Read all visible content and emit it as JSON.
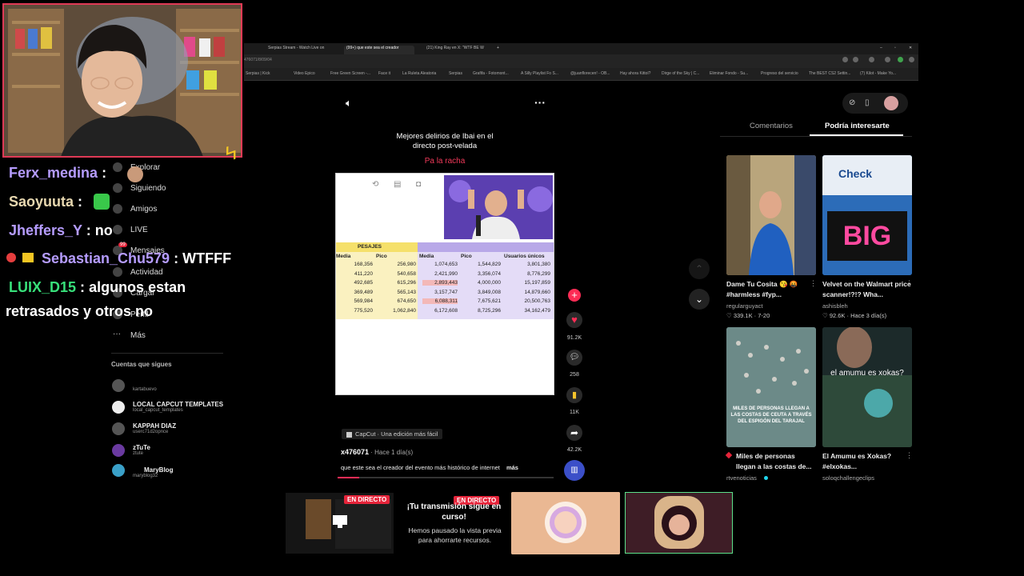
{
  "browser": {
    "tabs": [
      "Serpias Stream - Watch Live on",
      "(99+) que este sea el creador",
      "(21) King Ray en X: \"WTF BE W"
    ],
    "address": "476071/8/09/04",
    "bookmarks": [
      "Serpias | Kick",
      "Video Epico",
      "Free Green Screen -...",
      "Face it",
      "La Ruleta Aleatoria",
      "Serpias",
      "Grafifa - Fotomont...",
      "A Silly Playlist Fo S...",
      "@juanflorecen! - OB...",
      "Hay ahora Kittol?",
      "Dirge of the Sky | C...",
      "Eliminar Fondo - Su...",
      "Progreso del servicio",
      "The BEST CS2 Settin...",
      "(7) Kilot - Make Yo..."
    ]
  },
  "chat": [
    {
      "user": "Ferx_medina",
      "sep": " :",
      "msg": "",
      "color": "#b59cff"
    },
    {
      "user": "Saoyuuta",
      "sep": " :",
      "msg": "",
      "color": "#e8d8b0"
    },
    {
      "user": "Jheffers_Y",
      "sep": " :",
      "msg": "no",
      "color": "#b59cff"
    },
    {
      "user": "Sebastian_Chu579",
      "sep": " :",
      "msg": "WTFFF",
      "color": "#b59cff"
    },
    {
      "user": "LUIX_D15",
      "sep": " :",
      "msg": "algunos estan",
      "color": "#38e07a"
    },
    {
      "user": "",
      "sep": "",
      "msg": "retrasados y otros no",
      "color": "#fff"
    }
  ],
  "sidebar": {
    "items": [
      "Explorar",
      "Siguiendo",
      "Amigos",
      "LIVE",
      "Mensajes",
      "Actividad",
      "Cargar",
      "Perfil",
      "Más"
    ],
    "messages_badge": "99",
    "following_title": "Cuentas que sigues",
    "accounts": [
      {
        "name": "",
        "sub": "kartabuevo"
      },
      {
        "name": "LOCAL CAPCUT TEMPLATES",
        "sub": "local_capcut_templates"
      },
      {
        "name": "KAPPAH DIAZ",
        "sub": "userc71d2opnce"
      },
      {
        "name": "zTuTe",
        "sub": "ztute"
      },
      {
        "name": "MaryBlog",
        "sub": "maryblog32"
      }
    ]
  },
  "video": {
    "overlay_title": "Mejores delirios de Ibai en el directo post-velada",
    "overlay_sub": "Pa la racha",
    "sheet": {
      "group_header": "PESAJES",
      "headers": [
        "Media",
        "Pico",
        "Media",
        "Pico",
        "Usuarios únicos"
      ],
      "rows": [
        [
          "168,356",
          "256,980",
          "1,074,653",
          "1,544,829",
          "3,801,380"
        ],
        [
          "411,220",
          "540,658",
          "2,421,990",
          "3,356,074",
          "8,776,299"
        ],
        [
          "492,685",
          "615,296",
          "2,893,443",
          "4,000,000",
          "15,197,859"
        ],
        [
          "369,489",
          "565,143",
          "3,157,747",
          "3,849,008",
          "14,879,660"
        ],
        [
          "569,984",
          "674,650",
          "6,088,311",
          "7,675,621",
          "20,500,763"
        ],
        [
          "775,520",
          "1,062,840",
          "6,172,608",
          "8,725,296",
          "34,162,479"
        ]
      ]
    },
    "likes": "91.2K",
    "comments": "258",
    "saves": "11K",
    "shares": "42.2K",
    "capcut": "CapCut · Una edición más fácil",
    "author": "x476071",
    "time": " · Hace 1 día(s)",
    "caption": "que este sea el creador del evento más histórico de internet",
    "more": "más"
  },
  "right_panel": {
    "tabs": [
      "Comentarios",
      "Podría interesarte"
    ],
    "videos": [
      {
        "title": "Dame Tu Cosita 😘 🤬 #harmless #fyp...",
        "author": "regularguyact",
        "stats": "339.1K · 7-20"
      },
      {
        "title": "Velvet on the Walmart price scanner!?!? Wha...",
        "author": "ashisbleh",
        "stats": "92.6K · Hace 3 día(s)"
      },
      {
        "title": "Miles de personas llegan a las costas de...",
        "author": "rtvenoticias",
        "stats": ""
      },
      {
        "title": "El Amumu es Xokas? #elxokas...",
        "author": "soloqchallengeclips",
        "stats": ""
      }
    ],
    "thumb_texts": [
      "Check",
      "BIG",
      "MILES DE PERSONAS LLEGAN A LAS COSTAS DE CEUTA A TRAVÉS DEL ESPIGÓN DEL TARAJAL",
      "el amumu es xokas?"
    ]
  },
  "bottom": {
    "live_label": "EN DIRECTO",
    "notice_title": "¡Tu transmisión sigue en curso!",
    "notice_body": "Hemos pausado la vista previa para ahorrarte recursos."
  }
}
